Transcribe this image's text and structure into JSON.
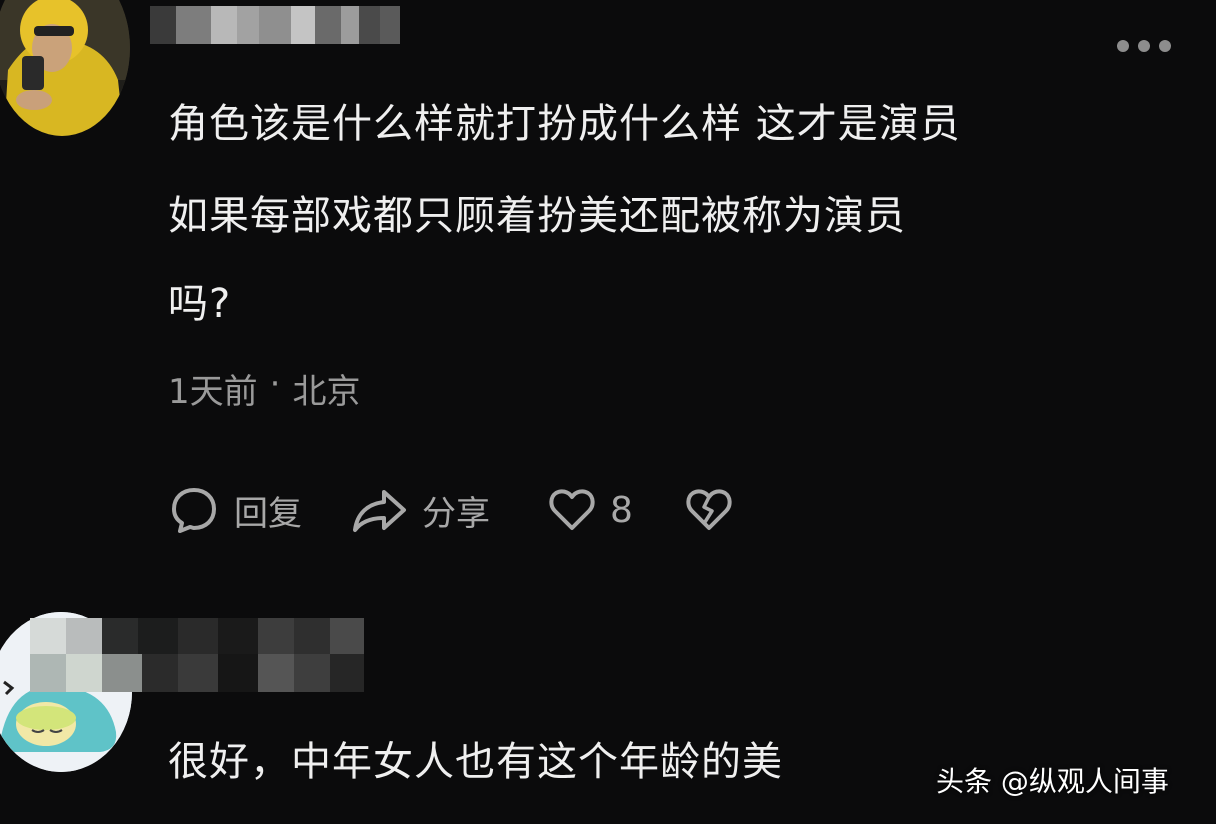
{
  "comment1": {
    "username": "",
    "text_lines": [
      "角色该是什么样就打扮成什么样 这才是演员",
      "如果每部戏都只顾着扮美还配被称为演员",
      "吗?"
    ],
    "time": "1天前",
    "separator": "·",
    "location": "北京",
    "reply_label": "回复",
    "share_label": "分享",
    "like_count": "8"
  },
  "comment2": {
    "username": "",
    "text": "很好，中年女人也有这个年龄的美"
  },
  "watermark": "头条 @纵观人间事",
  "icons": {
    "more": "more-dots-icon",
    "reply": "comment-bubble-icon",
    "share": "share-arrow-icon",
    "like": "heart-icon",
    "dislike": "broken-heart-icon"
  },
  "colors": {
    "background": "#0b0b0c",
    "text": "#efefef",
    "secondary_text": "#9a9a9a",
    "icon": "#a8a8a8"
  }
}
